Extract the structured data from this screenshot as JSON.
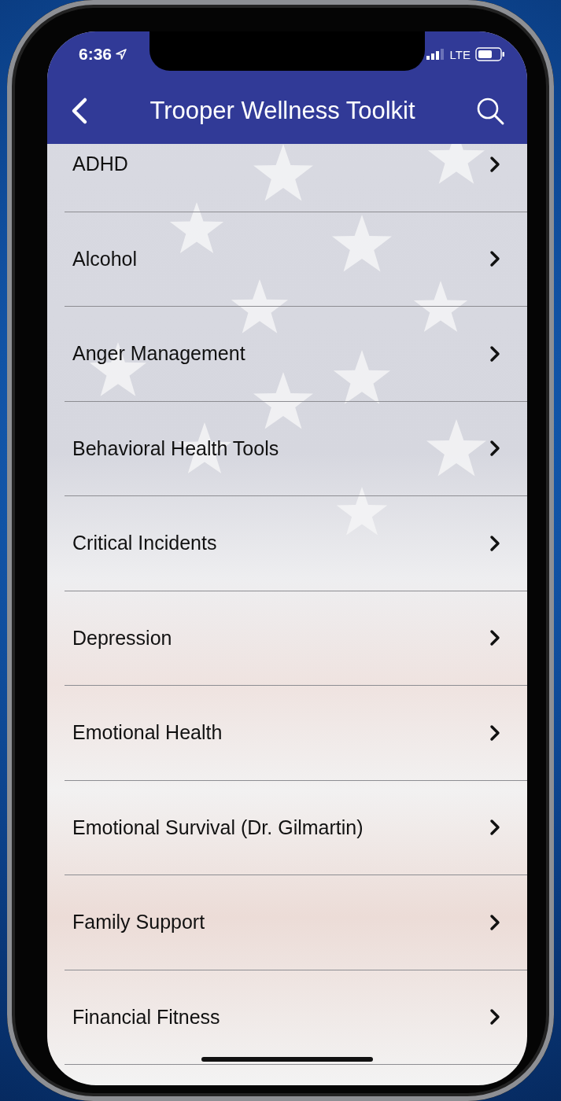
{
  "status_bar": {
    "time": "6:36",
    "network": "LTE"
  },
  "nav_bar": {
    "title": "Trooper Wellness Toolkit"
  },
  "items": [
    {
      "label": "ADHD"
    },
    {
      "label": "Alcohol"
    },
    {
      "label": "Anger Management"
    },
    {
      "label": "Behavioral Health Tools"
    },
    {
      "label": "Critical Incidents"
    },
    {
      "label": "Depression"
    },
    {
      "label": "Emotional Health"
    },
    {
      "label": "Emotional Survival (Dr. Gilmartin)"
    },
    {
      "label": "Family Support"
    },
    {
      "label": "Financial Fitness"
    }
  ]
}
